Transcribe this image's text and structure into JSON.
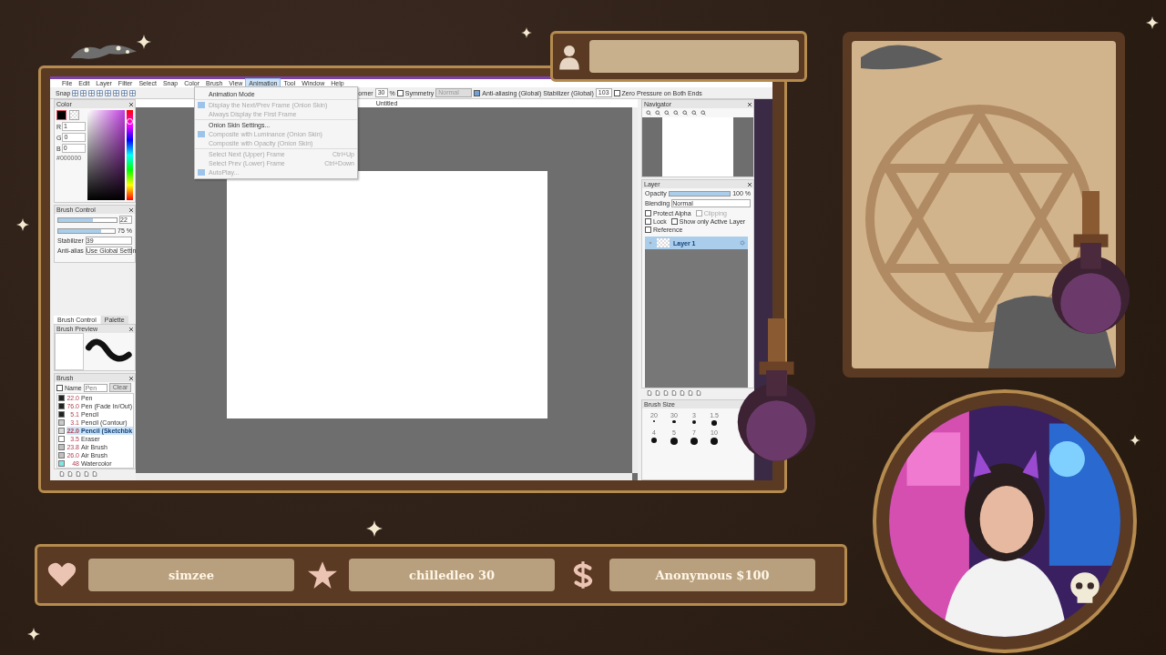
{
  "menu_bar": [
    {
      "label": "File",
      "selected": false
    },
    {
      "label": "Edit",
      "selected": false
    },
    {
      "label": "Layer",
      "selected": false
    },
    {
      "label": "Filter",
      "selected": false
    },
    {
      "label": "Select",
      "selected": false
    },
    {
      "label": "Snap",
      "selected": false
    },
    {
      "label": "Color",
      "selected": false
    },
    {
      "label": "Brush",
      "selected": false
    },
    {
      "label": "View",
      "selected": false
    },
    {
      "label": "Animation",
      "selected": true
    },
    {
      "label": "Tool",
      "selected": false
    },
    {
      "label": "Window",
      "selected": false
    },
    {
      "label": "Help",
      "selected": false
    }
  ],
  "animation_menu": [
    {
      "label": "Animation Mode",
      "checked": false,
      "disabled": false,
      "separator_before": false
    },
    {
      "label": "Display the Next/Prev Frame (Onion Skin)",
      "checked": true,
      "disabled": true,
      "separator_before": true
    },
    {
      "label": "Always Display the First Frame",
      "checked": false,
      "disabled": true,
      "separator_before": false
    },
    {
      "label": "Onion Skin Settings...",
      "checked": false,
      "disabled": false,
      "separator_before": true
    },
    {
      "label": "Composite with Luminance (Onion Skin)",
      "checked": true,
      "disabled": true,
      "separator_before": false
    },
    {
      "label": "Composite with Opacity (Onion Skin)",
      "checked": false,
      "disabled": true,
      "separator_before": false
    },
    {
      "label": "Select Next (Upper) Frame",
      "shortcut": "Ctrl+Up",
      "checked": false,
      "disabled": true,
      "separator_before": true
    },
    {
      "label": "Select Prev (Lower) Frame",
      "shortcut": "Ctrl+Down",
      "checked": false,
      "disabled": true,
      "separator_before": false
    },
    {
      "label": "AutoPlay...",
      "checked": true,
      "disabled": true,
      "separator_before": false
    }
  ],
  "toolbar": {
    "snap_label": "Snap",
    "corner_label": "orner",
    "corner_value": "30",
    "percent": "%",
    "symmetry": {
      "label": "Symmetry",
      "checked": false
    },
    "symmetry_mode": "Normal",
    "anti_aliasing": {
      "label": "Anti-aliasing (Global)",
      "checked": true
    },
    "stabilizer_label": "Stabilizer (Global)",
    "stabilizer_value": "103",
    "zero_pressure": {
      "label": "Zero Pressure on Both Ends",
      "checked": false
    }
  },
  "document_tab": "Untitled",
  "color_panel": {
    "title": "Color",
    "fields": [
      {
        "label": "R",
        "value": "1"
      },
      {
        "label": "G",
        "value": "0"
      },
      {
        "label": "B",
        "value": "0"
      }
    ],
    "hex": "#000000",
    "hue_slider": {
      "level": 0.88
    }
  },
  "brush_control": {
    "title": "Brush Control",
    "size_slider": {
      "level": 0.6
    },
    "size": "22",
    "density_slider": {
      "level": 0.75
    },
    "density": "75 %",
    "stabilizer_label": "Stabilizer",
    "stabilizer": "39",
    "anti_alias_label": "Anti-alias",
    "anti_alias": "Use Global Settin"
  },
  "panel_tabs": [
    {
      "label": "Brush Control",
      "selected": true
    },
    {
      "label": "Palette",
      "selected": false
    }
  ],
  "brush_preview": {
    "title": "Brush Preview"
  },
  "brush_panel": {
    "title": "Brush",
    "name_filter": {
      "label": "Name",
      "checked": false
    },
    "search": {
      "placeholder": "Pen"
    },
    "clear": "Clear",
    "brushes": [
      {
        "size": "22.0",
        "name": "Pen",
        "color": "#222222",
        "selected": false
      },
      {
        "size": "76.0",
        "name": "Pen (Fade In/Out)",
        "color": "#222222",
        "selected": false
      },
      {
        "size": "5.1",
        "name": "Pencil",
        "color": "#222222",
        "selected": false
      },
      {
        "size": "3.1",
        "name": "Pencil (Contour)",
        "color": "#c8c8c8",
        "selected": false
      },
      {
        "size": "22.0",
        "name": "Pencil (Sketchbk",
        "color": "#d8d8d8",
        "selected": true
      },
      {
        "size": "3.5",
        "name": "Eraser",
        "color": "#ffffff",
        "selected": false
      },
      {
        "size": "23.8",
        "name": "Air Brush",
        "color": "#c0c0c0",
        "selected": false
      },
      {
        "size": "26.0",
        "name": "Air Brush",
        "color": "#c0c0c0",
        "selected": false
      },
      {
        "size": "48",
        "name": "Watercolor",
        "color": "#7fe6e6",
        "selected": false
      }
    ]
  },
  "navigator": {
    "title": "Navigator"
  },
  "layer_panel": {
    "title": "Layer",
    "opacity_label": "Opacity",
    "opacity_slider": {
      "level": 1
    },
    "opacity": "100 %",
    "blending_label": "Blending",
    "blending": "Normal",
    "options": [
      {
        "label": "Protect Alpha",
        "checked": false,
        "disabled": false
      },
      {
        "label": "Clipping",
        "checked": false,
        "disabled": true
      },
      {
        "label": "Lock",
        "checked": false,
        "disabled": false
      },
      {
        "label": "Show only Active Layer",
        "checked": false,
        "disabled": false
      },
      {
        "label": "Reference",
        "checked": false,
        "disabled": false
      }
    ],
    "layers": [
      {
        "name": "Layer 1",
        "selected": true
      }
    ]
  },
  "brush_size": {
    "title": "Brush Size",
    "sizes": [
      "20",
      "30",
      "3",
      "1.5",
      "4",
      "5",
      "7",
      "10"
    ]
  },
  "alerts": [
    {
      "kind": "heart",
      "text": "simzee"
    },
    {
      "kind": "star",
      "text": "chilledleo 30"
    },
    {
      "kind": "dollar",
      "text": "Anonymous $100"
    }
  ]
}
